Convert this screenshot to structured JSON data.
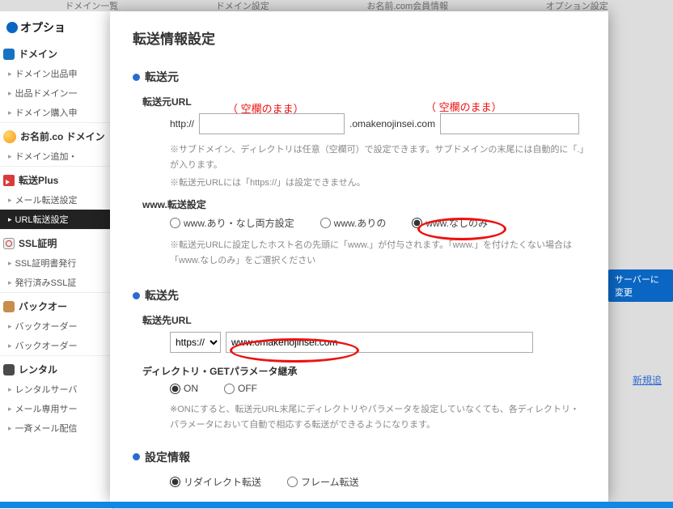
{
  "topnav": {
    "items": [
      "ドメイン一覧",
      "ドメイン設定",
      "お名前.com会員情報",
      "オプション設定"
    ]
  },
  "sidebar": {
    "option_title": "オプショ",
    "groups": [
      {
        "icon": "domain",
        "title": "ドメイン",
        "items": [
          "ドメイン出品申",
          "出品ドメイン一",
          "ドメイン購入申"
        ]
      },
      {
        "icon": "onamae",
        "title": "お名前.co\nドメイン",
        "items": [
          "ドメイン追加・"
        ]
      },
      {
        "icon": "plus",
        "title": "転送Plus",
        "items": [
          "メール転送設定",
          "URL転送設定"
        ],
        "active_index": 1
      },
      {
        "icon": "ssl",
        "title": "SSL証明",
        "items": [
          "SSL証明書発行",
          "発行済みSSL証"
        ]
      },
      {
        "icon": "back",
        "title": "バックオー",
        "items": [
          "バックオーダー",
          "バックオーダー"
        ]
      },
      {
        "icon": "rental",
        "title": "レンタル",
        "items": [
          "レンタルサーバ",
          "メール専用サー",
          "一斉メール配信"
        ]
      }
    ]
  },
  "modal": {
    "title": "転送情報設定",
    "source": {
      "heading": "転送元",
      "url_label": "転送元URL",
      "http_prefix": "http://",
      "domain_suffix": ".omakenojinsei.com",
      "note1": "※サブドメイン、ディレクトリは任意（空欄可）で設定できます。サブドメインの末尾には自動的に「.」が入ります。",
      "note2": "※転送元URLには「https://」は設定できません。",
      "www_heading": "www.転送設定",
      "www_options": [
        "www.あり・なし両方設定",
        "www.ありの",
        "www.なしのみ"
      ],
      "www_note": "※転送元URLに設定したホスト名の先頭に「www.」が付与されます。「www.」を付けたくない場合は「www.なしのみ」をご選択ください"
    },
    "dest": {
      "heading": "転送先",
      "url_label": "転送先URL",
      "protocol": "https://",
      "value": "www.omakenojinsei.com",
      "inherit_label": "ディレクトリ・GETパラメータ継承",
      "on": "ON",
      "off": "OFF",
      "inherit_note": "※ONにすると、転送元URL末尾にディレクトリやパラメータを設定していなくても、各ディレクトリ・パラメータにおいて自動で相応する転送ができるようになります。"
    },
    "settings": {
      "heading": "設定情報",
      "opt1": "リダイレクト転送",
      "opt2": "フレーム転送"
    }
  },
  "annotations": {
    "blank1": "（ 空欄のまま）",
    "blank2": "（ 空欄のまま）"
  },
  "right": {
    "server": "サーバーに変更",
    "newlink": "新規追"
  }
}
